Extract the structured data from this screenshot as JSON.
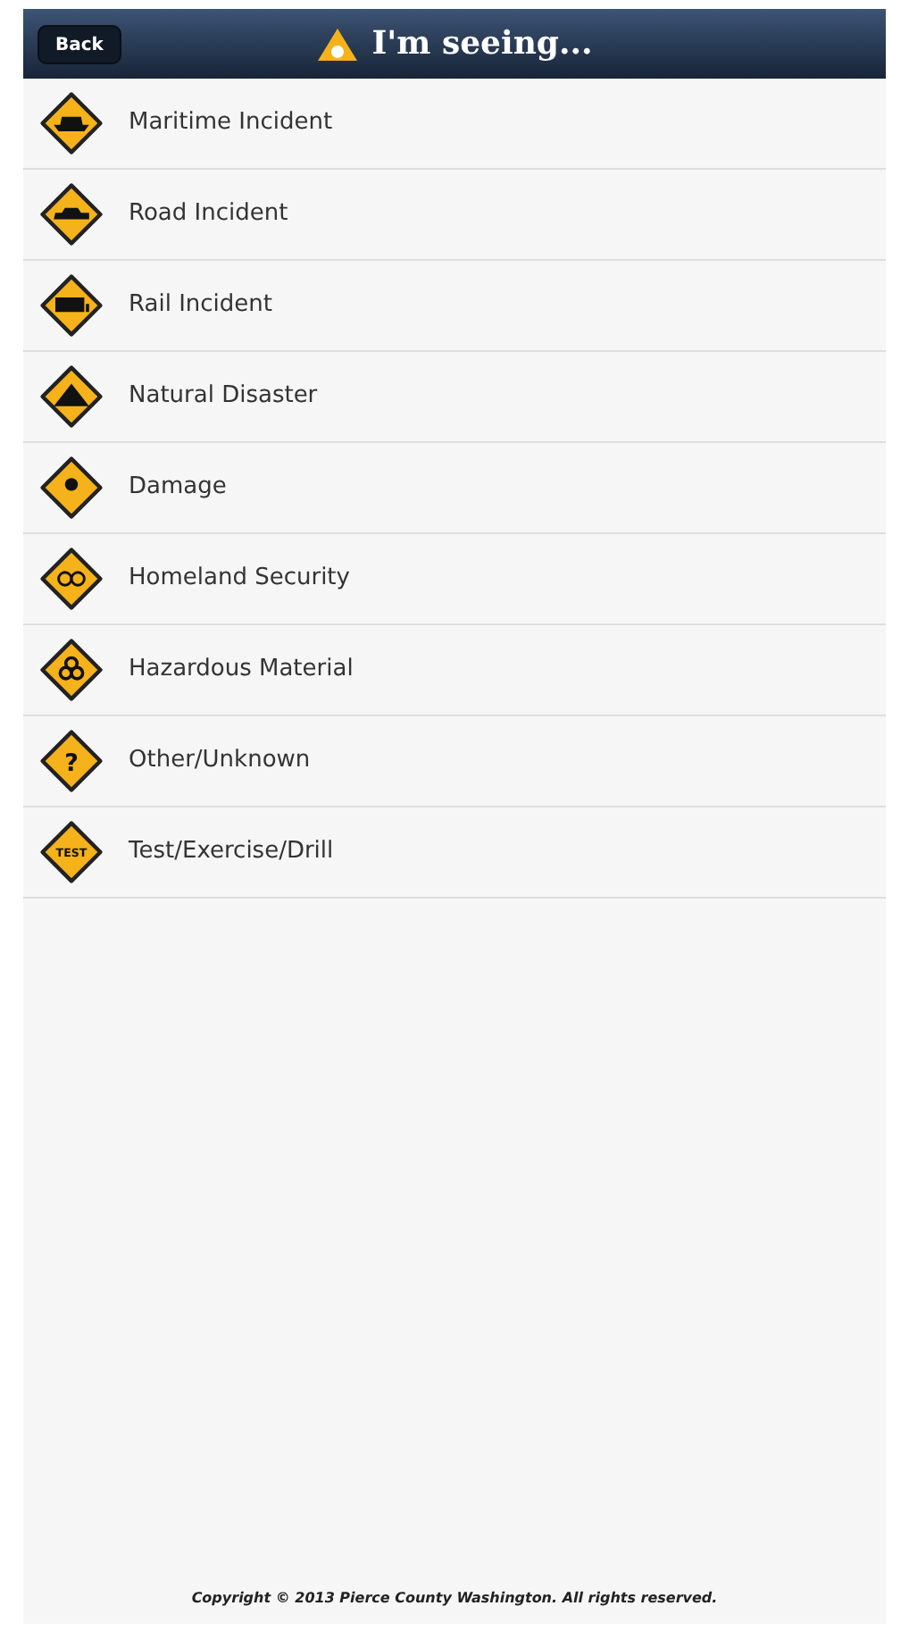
{
  "header": {
    "back": "Back",
    "title": "I'm seeing..."
  },
  "items": [
    {
      "label": "Maritime Incident",
      "kind": "ship"
    },
    {
      "label": "Road Incident",
      "kind": "car"
    },
    {
      "label": "Rail Incident",
      "kind": "train"
    },
    {
      "label": "Natural Disaster",
      "kind": "mountain"
    },
    {
      "label": "Damage",
      "kind": "burst"
    },
    {
      "label": "Homeland Security",
      "kind": "rings"
    },
    {
      "label": "Hazardous Material",
      "kind": "biohazard"
    },
    {
      "label": "Other/Unknown",
      "kind": "text",
      "icon_text": "?"
    },
    {
      "label": "Test/Exercise/Drill",
      "kind": "text",
      "icon_text": "TEST"
    }
  ],
  "footer": "Copyright © 2013 Pierce County Washington. All rights reserved."
}
